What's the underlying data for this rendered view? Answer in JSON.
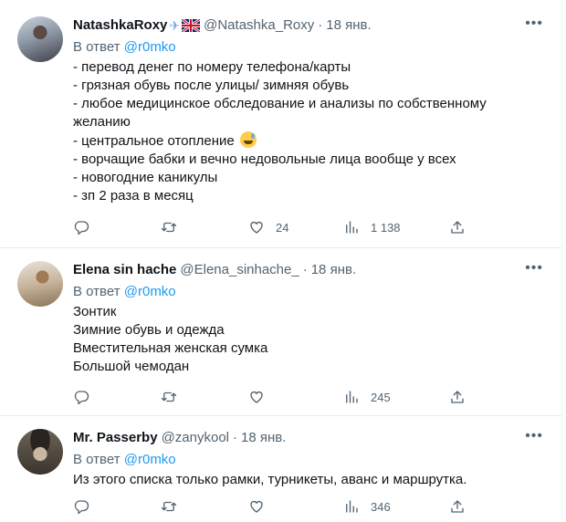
{
  "tweets": [
    {
      "name": "NatashkaRoxy",
      "handle": "@Natashka_Roxy",
      "dot": "·",
      "date": "18 янв.",
      "reply_prefix": "В ответ",
      "reply_to": "@r0mko",
      "lines": [
        "- перевод денег по номеру телефона/карты",
        "- грязная обувь после улицы/ зимняя обувь",
        "- любое медицинское обследование и анализы по собственному",
        "желанию",
        "- центральное отопление",
        "- ворчащие бабки и вечно недовольные лица вообще у всех",
        "- новогодние каникулы",
        "- зп 2 раза в месяц"
      ],
      "likes": "24",
      "views": "1 138"
    },
    {
      "name": "Elena sin hache",
      "handle": "@Elena_sinhache_",
      "dot": "·",
      "date": "18 янв.",
      "reply_prefix": "В ответ",
      "reply_to": "@r0mko",
      "lines": [
        "Зонтик",
        "Зимние обувь и одежда",
        "Вместительная женская сумка",
        "Большой чемодан"
      ],
      "likes": "",
      "views": "245"
    },
    {
      "name": "Mr. Passerby",
      "handle": "@zanykool",
      "dot": "·",
      "date": "18 янв.",
      "reply_prefix": "В ответ",
      "reply_to": "@r0mko",
      "lines": [
        "Из этого списка только рамки, турникеты, аванс и маршрутка."
      ],
      "likes": "",
      "views": "346"
    }
  ],
  "icons": {
    "more": "more-icon",
    "reply": "reply-icon",
    "retweet": "retweet-icon",
    "like": "heart-icon",
    "views": "views-icon",
    "share": "share-icon"
  },
  "colors": {
    "link": "#1d9bf0",
    "secondary": "#536471",
    "text": "#0f1419"
  }
}
